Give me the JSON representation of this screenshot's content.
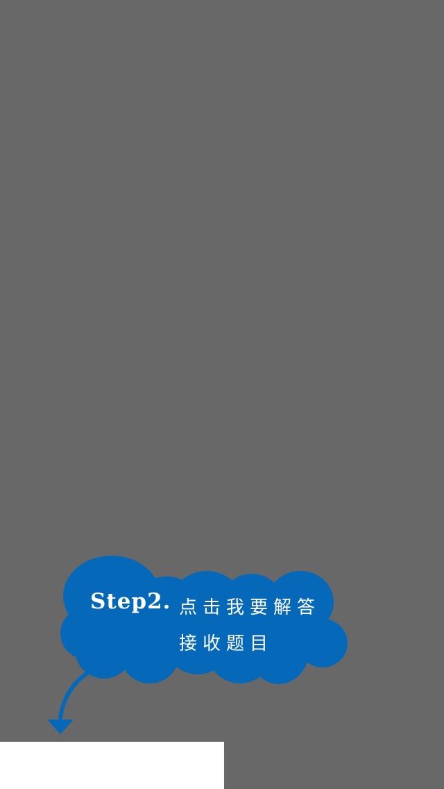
{
  "tutorial": {
    "step": "Step2.",
    "instruction_line1": "点击我要解答",
    "instruction_line2": "接收题目"
  },
  "colors": {
    "overlay": "#686868",
    "cloud": "#0568b9",
    "text": "#ffffff",
    "highlight": "#ffffff"
  },
  "icons": {
    "cloud": "speech-cloud-icon",
    "arrow": "curved-arrow-down-icon"
  }
}
